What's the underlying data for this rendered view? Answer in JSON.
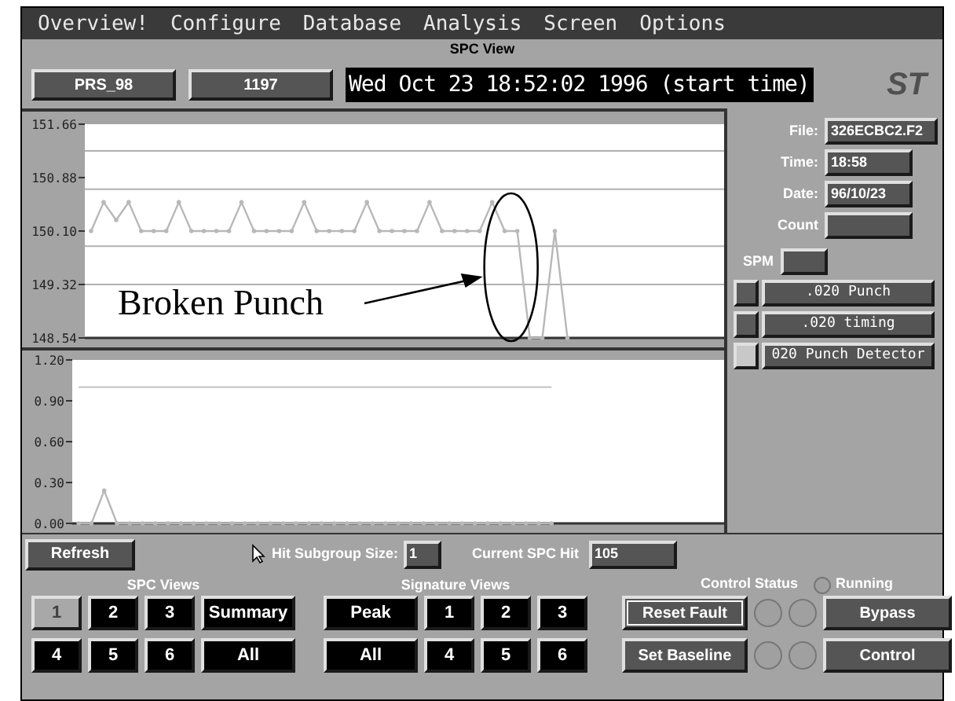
{
  "menu": [
    "Overview!",
    "Configure",
    "Database",
    "Analysis",
    "Screen",
    "Options"
  ],
  "window": {
    "title": "SPC View"
  },
  "toolbar": {
    "part": "PRS_98",
    "count": "1197",
    "start_time": "Wed Oct 23 18:52:02 1996 (start time)",
    "logo": "ST"
  },
  "charts": [
    {
      "chart_data": {
        "type": "line",
        "categories": [
          null,
          null,
          null,
          null,
          null,
          null,
          null,
          null,
          null,
          null,
          null,
          null,
          null,
          null,
          null,
          null,
          null,
          null,
          null,
          null,
          null,
          null,
          null,
          null,
          null,
          null,
          null,
          null,
          null,
          null,
          null,
          null,
          null,
          null,
          null,
          null,
          null,
          null,
          null,
          null,
          null,
          null,
          null,
          null,
          null,
          null,
          null,
          null,
          null,
          null,
          null
        ],
        "ylim": [
          148.54,
          151.66
        ],
        "yticks": [
          {
            "value": 148.54,
            "label": "148.54"
          },
          {
            "value": 149.32,
            "label": "149.32"
          },
          {
            "value": 150.1,
            "label": "150.10"
          },
          {
            "value": 150.88,
            "label": "150.88"
          },
          {
            "value": 151.66,
            "label": "151.66"
          }
        ],
        "series": [
          {
            "color": "#b8b8b8",
            "marker": true,
            "values": [
              150.1,
              150.52,
              150.26,
              150.52,
              150.1,
              150.1,
              150.1,
              150.52,
              150.1,
              150.1,
              150.1,
              150.1,
              150.52,
              150.1,
              150.1,
              150.1,
              150.1,
              150.52,
              150.1,
              150.1,
              150.1,
              150.1,
              150.52,
              150.1,
              150.1,
              150.1,
              150.1,
              150.52,
              150.1,
              150.1,
              150.1,
              150.1,
              150.52,
              150.1,
              150.1,
              148.54,
              148.54,
              150.1,
              148.54,
              null,
              null,
              null,
              null,
              null,
              null,
              null,
              null,
              null,
              null,
              null,
              null
            ]
          }
        ],
        "annotations": [
          "Broken Punch"
        ]
      }
    },
    {
      "chart_data": {
        "type": "line",
        "categories": [
          null,
          null,
          null,
          null,
          null,
          null,
          null,
          null,
          null,
          null,
          null,
          null,
          null,
          null,
          null,
          null,
          null,
          null,
          null,
          null,
          null,
          null,
          null,
          null,
          null,
          null,
          null,
          null,
          null,
          null,
          null,
          null,
          null,
          null,
          null,
          null,
          null,
          null,
          null,
          null,
          null,
          null,
          null,
          null,
          null,
          null,
          null,
          null,
          null,
          null,
          null
        ],
        "ylim": [
          0,
          1.2
        ],
        "yticks": [
          {
            "value": 0,
            "label": "0.00"
          },
          {
            "value": 0.3,
            "label": "0.30"
          },
          {
            "value": 0.6,
            "label": "0.60"
          },
          {
            "value": 0.9,
            "label": "0.90"
          },
          {
            "value": 1.2,
            "label": "1.20"
          }
        ],
        "series": [
          {
            "color": "#b8b8b8",
            "marker": true,
            "values": [
              0,
              0,
              0.24,
              0,
              0,
              0,
              0,
              0,
              0,
              0,
              0,
              0,
              0,
              0,
              0,
              0,
              0,
              0,
              0,
              0,
              0,
              0,
              0,
              0,
              0,
              0,
              0,
              0,
              0,
              0,
              0,
              0,
              0,
              0,
              0,
              0,
              0,
              0,
              null,
              null,
              null,
              null,
              null,
              null,
              null,
              null,
              null,
              null,
              null,
              null,
              null
            ]
          },
          {
            "color": "#c8c8c8",
            "marker": false,
            "values": [
              1,
              1,
              1,
              1,
              1,
              1,
              1,
              1,
              1,
              1,
              1,
              1,
              1,
              1,
              1,
              1,
              1,
              1,
              1,
              1,
              1,
              1,
              1,
              1,
              1,
              1,
              1,
              1,
              1,
              1,
              1,
              1,
              1,
              1,
              1,
              1,
              1,
              1,
              null,
              null,
              null,
              null,
              null,
              null,
              null,
              null,
              null,
              null,
              null,
              null,
              null
            ]
          }
        ]
      }
    }
  ],
  "info": [
    {
      "label": "File:",
      "value": "326ECBC2.F2"
    },
    {
      "label": "Time:",
      "value": "18:58"
    },
    {
      "label": "Date:",
      "value": "96/10/23"
    },
    {
      "label": "Count"
    }
  ],
  "spm": {
    "label": "SPM"
  },
  "channels": [
    {
      "name": ".020 Punch",
      "on": false
    },
    {
      "name": ".020 timing",
      "on": false
    },
    {
      "name": "020 Punch Detector",
      "on": true
    }
  ],
  "refresh": "Refresh",
  "subgroup": {
    "label": "Hit Subgroup Size:",
    "value": "1"
  },
  "current_hit": {
    "label": "Current SPC Hit",
    "value": "105"
  },
  "spc_views": {
    "title": "SPC Views",
    "buttons": [
      {
        "label": "1",
        "selected": true
      },
      {
        "label": "2",
        "selected": false
      },
      {
        "label": "3",
        "selected": false
      },
      {
        "label": "Summary",
        "selected": false
      },
      {
        "label": "4",
        "selected": false
      },
      {
        "label": "5",
        "selected": false
      },
      {
        "label": "6",
        "selected": false
      },
      {
        "label": "All",
        "selected": false
      }
    ]
  },
  "signature_views": {
    "title": "Signature Views",
    "buttons": [
      {
        "label": "Peak",
        "selected": false
      },
      {
        "label": "1",
        "selected": false
      },
      {
        "label": "2",
        "selected": false
      },
      {
        "label": "3",
        "selected": false
      },
      {
        "label": "All",
        "selected": false
      },
      {
        "label": "4",
        "selected": false
      },
      {
        "label": "5",
        "selected": false
      },
      {
        "label": "6",
        "selected": false
      }
    ]
  },
  "control_status": {
    "title": "Control Status",
    "running": {
      "label": "Running",
      "on": false
    },
    "rows": [
      {
        "action": {
          "label": "Reset Fault",
          "default": true
        },
        "lamps": [
          false,
          false
        ],
        "mode": "Bypass"
      },
      {
        "action": {
          "label": "Set Baseline",
          "default": false
        },
        "lamps": [
          false,
          false
        ],
        "mode": "Control"
      }
    ]
  }
}
